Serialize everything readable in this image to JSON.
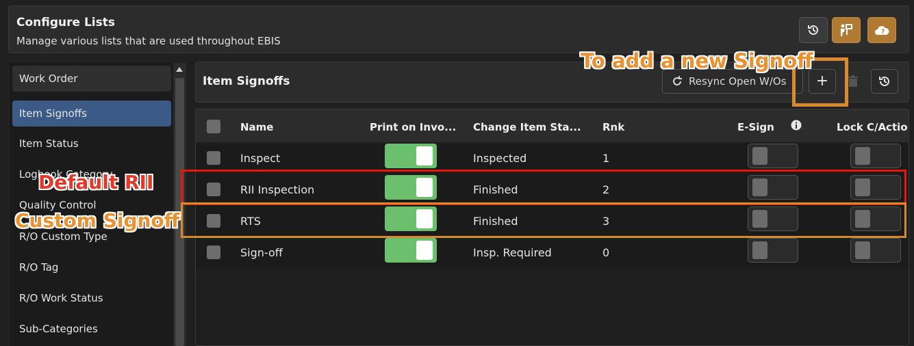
{
  "header": {
    "title": "Configure Lists",
    "subtitle": "Manage various lists that are used throughout EBIS",
    "buttons": [
      {
        "icon": "history-icon"
      },
      {
        "icon": "person-sign-icon"
      },
      {
        "icon": "cloud-help-icon"
      }
    ]
  },
  "sidebar": {
    "items": [
      {
        "label": "Work Order"
      },
      {
        "label": "Item Signoffs"
      },
      {
        "label": "Item Status"
      },
      {
        "label": "Logbook Category"
      },
      {
        "label": "Quality Control"
      },
      {
        "label": "R/O Custom Type"
      },
      {
        "label": "R/O Tag"
      },
      {
        "label": "R/O Work Status"
      },
      {
        "label": "Sub-Categories"
      }
    ],
    "active": "Item Signoffs"
  },
  "panel": {
    "title": "Item Signoffs",
    "resync_label": "Resync Open W/Os",
    "add_label": "+"
  },
  "table": {
    "columns": {
      "name": "Name",
      "print": "Print on Invo...",
      "change": "Change Item Sta...",
      "rnk": "Rnk",
      "esign": "E-Sign",
      "lock": "Lock C/Actio"
    },
    "rows": [
      {
        "name": "Inspect",
        "print_on_invoice": true,
        "change_item_status": "Inspected",
        "rnk": "1",
        "esign": false,
        "lock": false
      },
      {
        "name": "RII Inspection",
        "print_on_invoice": true,
        "change_item_status": "Finished",
        "rnk": "2",
        "esign": false,
        "lock": false
      },
      {
        "name": "RTS",
        "print_on_invoice": true,
        "change_item_status": "Finished",
        "rnk": "3",
        "esign": false,
        "lock": false
      },
      {
        "name": "Sign-off",
        "print_on_invoice": true,
        "change_item_status": "Insp. Required",
        "rnk": "0",
        "esign": false,
        "lock": false
      }
    ]
  },
  "annotations": {
    "add_new": "To add a new Signoff",
    "default_rii": "Default RII",
    "custom_signoff": "Custom Signoff"
  },
  "colors": {
    "accent_gold": "#b07a32",
    "active_blue": "#3c5a86",
    "toggle_green": "#6cbf6c",
    "annotation_red": "#e8170c",
    "annotation_orange": "#d98a30"
  }
}
